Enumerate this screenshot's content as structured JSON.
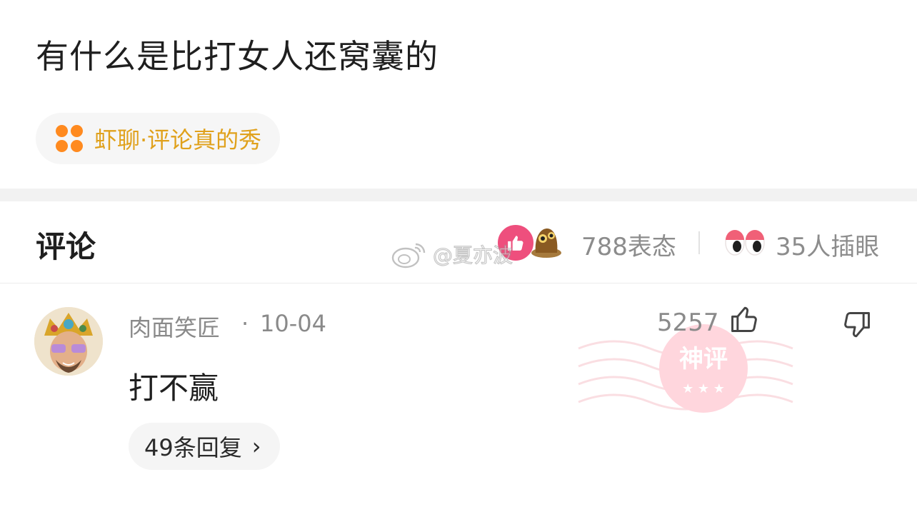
{
  "post": {
    "title": "有什么是比打女人还窝囊的",
    "topic": "虾聊·评论真的秀"
  },
  "comments_header": {
    "title": "评论",
    "reactions": "788表态",
    "peeks": "35人插眼"
  },
  "watermark": {
    "text": "@夏亦波"
  },
  "comment": {
    "username": "肉面笑匠",
    "separator": "·",
    "date": "10-04",
    "text": "打不赢",
    "likes": "5257",
    "replies": "49条回复",
    "chevron": "›",
    "stamp_text": "神评"
  },
  "colors": {
    "topic_icon": "#ff8a1f",
    "topic_text": "#e0a11c",
    "reaction_pink": "#ee4f7d",
    "muted_text": "#8a8a8a",
    "divider": "#f2f2f2"
  },
  "icons": {
    "topic": "four-dots-icon",
    "reaction_1": "thumbs-up-reaction-icon",
    "reaction_2": "creature-reaction-icon",
    "peek": "eyes-icon",
    "like": "thumbs-up-icon",
    "dislike": "thumbs-down-icon",
    "watermark": "weibo-logo-icon"
  }
}
